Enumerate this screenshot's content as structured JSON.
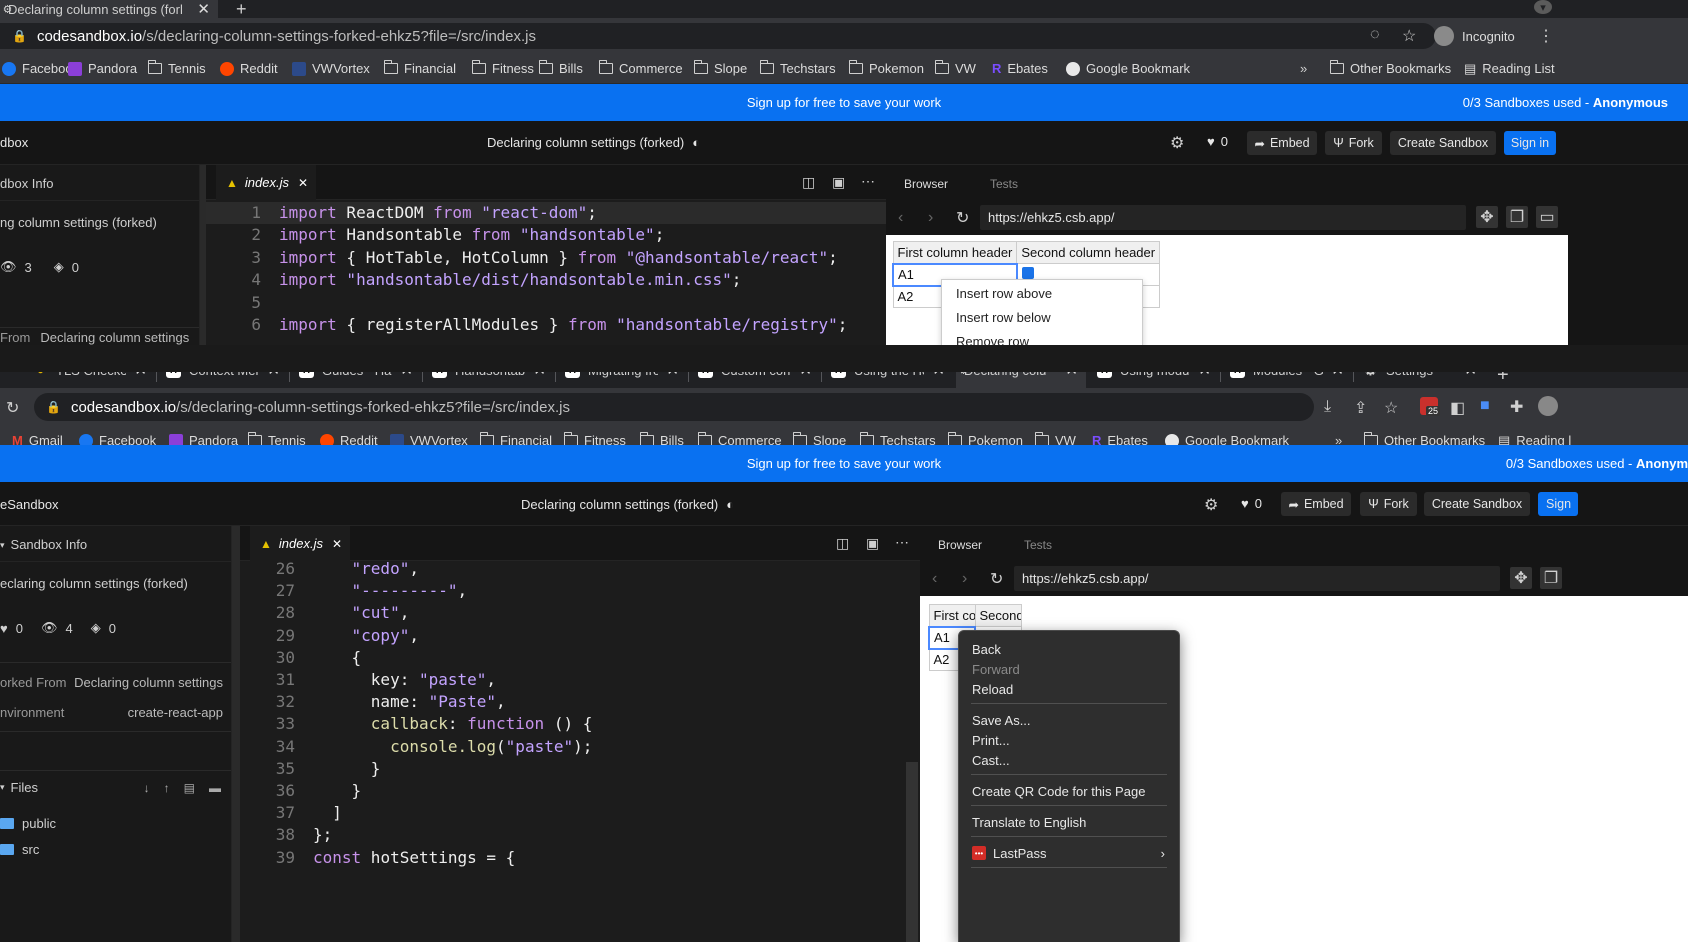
{
  "window1": {
    "active_tab": "Declaring column settings (forl",
    "url_domain": "codesandbox.io",
    "url_path": "/s/declaring-column-settings-forked-ehkz5?file=/src/index.js",
    "incognito_label": "Incognito",
    "bookmarks": [
      "Facebook",
      "Pandora",
      "Tennis",
      "Reddit",
      "VWVortex",
      "Financial",
      "Fitness",
      "Bills",
      "Commerce",
      "Slope",
      "Techstars",
      "Pokemon",
      "VW",
      "Ebates",
      "Google Bookmark"
    ],
    "other_bookmarks": "Other Bookmarks",
    "reading_list": "Reading List",
    "banner": {
      "text": "Sign up for free to save your work",
      "used": "0/3 Sandboxes used - ",
      "user": "Anonymous"
    },
    "header": {
      "brand": "dbox",
      "title": "Declaring column settings (forked)",
      "likes": "0",
      "embed": "Embed",
      "fork": "Fork",
      "create": "Create Sandbox",
      "signin": "Sign in"
    },
    "sidebar": {
      "section": "dbox Info",
      "name": "ng column settings (forked)",
      "views": "3",
      "forks": "0",
      "forked_label": "From",
      "forked_value": "Declaring column settings"
    },
    "editor_tab": "index.js",
    "code": [
      {
        "n": "1",
        "t": [
          [
            "kw",
            "import"
          ],
          [
            "id",
            " ReactDOM "
          ],
          [
            "kw",
            "from"
          ],
          [
            "st",
            " \"react-dom\""
          ],
          [
            "id",
            ";"
          ]
        ]
      },
      {
        "n": "2",
        "t": [
          [
            "kw",
            "import"
          ],
          [
            "id",
            " Handsontable "
          ],
          [
            "kw",
            "from"
          ],
          [
            "st",
            " \"handsontable\""
          ],
          [
            "id",
            ";"
          ]
        ]
      },
      {
        "n": "3",
        "t": [
          [
            "kw",
            "import"
          ],
          [
            "id",
            " { HotTable, HotColumn } "
          ],
          [
            "kw",
            "from"
          ],
          [
            "st",
            " \"@handsontable/react\""
          ],
          [
            "id",
            ";"
          ]
        ]
      },
      {
        "n": "4",
        "t": [
          [
            "kw",
            "import"
          ],
          [
            "st",
            " \"handsontable/dist/handsontable.min.css\""
          ],
          [
            "id",
            ";"
          ]
        ]
      },
      {
        "n": "5",
        "t": []
      },
      {
        "n": "6",
        "t": [
          [
            "kw",
            "import"
          ],
          [
            "id",
            " { registerAllModules } "
          ],
          [
            "kw",
            "from"
          ],
          [
            "st",
            " \"handsontable/registry\""
          ],
          [
            "id",
            ";"
          ]
        ]
      }
    ],
    "preview": {
      "tab_browser": "Browser",
      "tab_tests": "Tests",
      "url": "https://ehkz5.csb.app/",
      "col1": "First column header",
      "col2": "Second column header",
      "r1": "A1",
      "r2": "A2",
      "ctx": [
        "Insert row above",
        "Insert row below",
        "Remove row"
      ]
    }
  },
  "window2": {
    "tabs": [
      "TLS Checker",
      "Context Menu",
      "Guides - Hand",
      "Handsontable",
      "Migrating from",
      "Custom conte",
      "Using the Hot",
      "Declaring colu",
      "Using module",
      "Modules - Gu",
      "Settings"
    ],
    "url_domain": "codesandbox.io",
    "url_path": "/s/declaring-column-settings-forked-ehkz5?file=/src/index.js",
    "badge": "25",
    "bookmarks": [
      "Gmail",
      "Facebook",
      "Pandora",
      "Tennis",
      "Reddit",
      "VWVortex",
      "Financial",
      "Fitness",
      "Bills",
      "Commerce",
      "Slope",
      "Techstars",
      "Pokemon",
      "VW",
      "Ebates",
      "Google Bookmark"
    ],
    "other_bookmarks": "Other Bookmarks",
    "reading_list": "Reading l",
    "banner": {
      "text": "Sign up for free to save your work",
      "used": "0/3 Sandboxes used - ",
      "user": "Anonym"
    },
    "header": {
      "brand": "eSandbox",
      "title": "Declaring column settings (forked)",
      "likes": "0",
      "embed": "Embed",
      "fork": "Fork",
      "create": "Create Sandbox",
      "signin": "Sign"
    },
    "sidebar": {
      "section": "Sandbox Info",
      "name": "eclaring column settings (forked)",
      "likes": "0",
      "views": "4",
      "forks": "0",
      "forked_label": "orked From",
      "forked_value": "Declaring column settings",
      "env_label": "nvironment",
      "env_value": "create-react-app",
      "files_label": "Files",
      "folders": [
        "public",
        "src"
      ]
    },
    "editor_tab": "index.js",
    "code": [
      {
        "n": "26",
        "t": [
          [
            "st",
            "    \"redo\""
          ],
          [
            "id",
            ","
          ]
        ]
      },
      {
        "n": "27",
        "t": [
          [
            "st",
            "    \"---------\""
          ],
          [
            "id",
            ","
          ]
        ]
      },
      {
        "n": "28",
        "t": [
          [
            "st",
            "    \"cut\""
          ],
          [
            "id",
            ","
          ]
        ]
      },
      {
        "n": "29",
        "t": [
          [
            "st",
            "    \"copy\""
          ],
          [
            "id",
            ","
          ]
        ]
      },
      {
        "n": "30",
        "t": [
          [
            "id",
            "    {"
          ]
        ]
      },
      {
        "n": "31",
        "t": [
          [
            "id",
            "      key: "
          ],
          [
            "st",
            "\"paste\""
          ],
          [
            "id",
            ","
          ]
        ]
      },
      {
        "n": "32",
        "t": [
          [
            "id",
            "      name: "
          ],
          [
            "st",
            "\"Paste\""
          ],
          [
            "id",
            ","
          ]
        ]
      },
      {
        "n": "33",
        "t": [
          [
            "fn",
            "      callback"
          ],
          [
            "id",
            ": "
          ],
          [
            "kw",
            "function"
          ],
          [
            "id",
            " () {"
          ]
        ]
      },
      {
        "n": "34",
        "t": [
          [
            "fn",
            "        console.log"
          ],
          [
            "id",
            "("
          ],
          [
            "st",
            "\"paste\""
          ],
          [
            "id",
            ");"
          ]
        ]
      },
      {
        "n": "35",
        "t": [
          [
            "id",
            "      }"
          ]
        ]
      },
      {
        "n": "36",
        "t": [
          [
            "id",
            "    }"
          ]
        ]
      },
      {
        "n": "37",
        "t": [
          [
            "id",
            "  ]"
          ]
        ]
      },
      {
        "n": "38",
        "t": [
          [
            "id",
            "};"
          ]
        ]
      },
      {
        "n": "39",
        "t": [
          [
            "kw",
            "const"
          ],
          [
            "id",
            " hotSettings = {"
          ]
        ]
      }
    ],
    "preview": {
      "tab_browser": "Browser",
      "tab_tests": "Tests",
      "url": "https://ehkz5.csb.app/",
      "col1": "First co",
      "col2": "Second",
      "r1": "A1",
      "r2": "A2"
    },
    "context_menu": {
      "back": "Back",
      "forward": "Forward",
      "reload": "Reload",
      "save_as": "Save As...",
      "print": "Print...",
      "cast": "Cast...",
      "qr": "Create QR Code for this Page",
      "translate": "Translate to English",
      "lastpass": "LastPass"
    }
  }
}
